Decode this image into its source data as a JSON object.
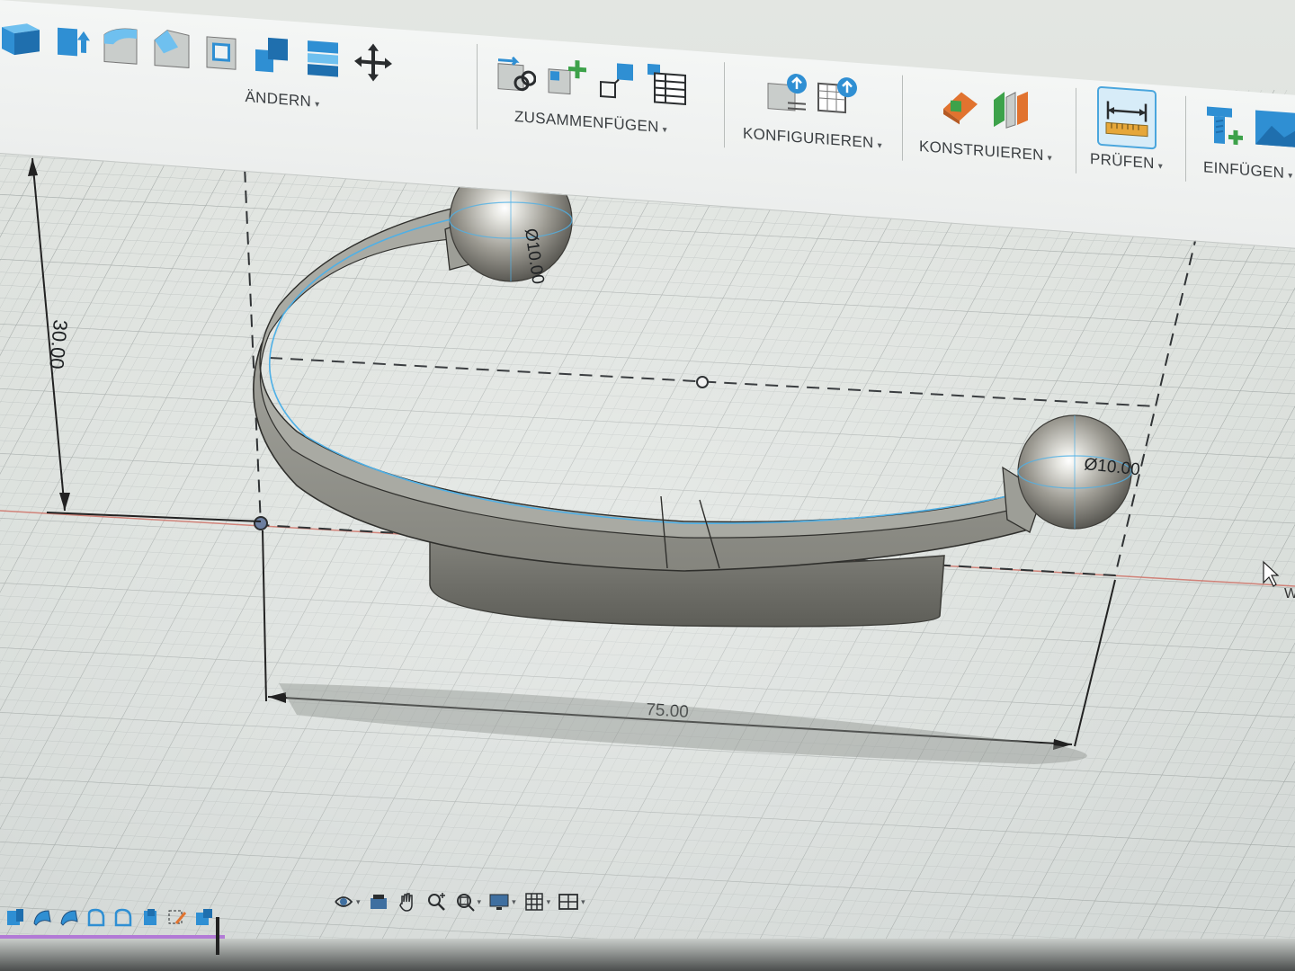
{
  "ribbon": {
    "groups": [
      {
        "label": "ÄNDERN"
      },
      {
        "label": "ZUSAMMENFÜGEN"
      },
      {
        "label": "KONFIGURIEREN"
      },
      {
        "label": "KONSTRUIEREN"
      },
      {
        "label": "PRÜFEN"
      },
      {
        "label": "EINFÜGEN"
      }
    ],
    "caret": "▾"
  },
  "viewport": {
    "dimensions": {
      "height": "30.00",
      "width": "75.00",
      "sphere_left_diameter": "Ø10.00",
      "sphere_right_diameter": "Ø10.00"
    },
    "axis_label_partial": "W"
  },
  "icons": {
    "ribbon": [
      "solid-box-icon",
      "push-pull-icon",
      "fillet-icon",
      "chamfer-icon",
      "shell-icon",
      "combine-icon",
      "stack-icon",
      "move-icon",
      "joint-icon",
      "new-component-icon",
      "rigid-group-icon",
      "table-icon",
      "parameters-icon",
      "config-table-icon",
      "offset-plane-icon",
      "midplane-icon",
      "measure-icon",
      "insert-mcmaster-icon",
      "insert-image-icon"
    ],
    "bottom": [
      "orbit-icon",
      "look-at-icon",
      "pan-icon",
      "zoom-icon",
      "fit-icon",
      "display-icon",
      "grid-icon",
      "viewports-icon"
    ],
    "timeline": [
      "sketch-feature-icon",
      "extrude-feature-icon",
      "revolve-feature-icon",
      "sweep-feature-icon",
      "loft-feature-icon",
      "pipe-feature-icon",
      "sketch-edit-icon",
      "body-feature-icon"
    ]
  },
  "colors": {
    "accent_blue": "#2f8fd3",
    "grid_line": "#b9bfbd",
    "viewport_bg": "#d9ddd8",
    "axis_red": "#cc5b4f",
    "model_gray": "#8e8e87",
    "timeline_purple": "#b27ad6"
  }
}
